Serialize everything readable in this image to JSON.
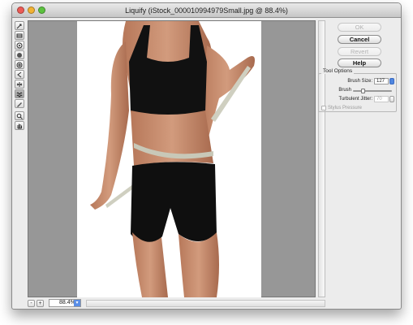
{
  "window": {
    "title": "Liquify (iStock_000010994979Small.jpg @ 88.4%)"
  },
  "tools": [
    {
      "name": "forward-warp-tool-icon",
      "active": false
    },
    {
      "name": "reconstruct-tool-icon",
      "active": false
    },
    {
      "name": "twirl-tool-icon",
      "active": false
    },
    {
      "name": "pucker-tool-icon",
      "active": false
    },
    {
      "name": "bloat-tool-icon",
      "active": false
    },
    {
      "name": "push-left-tool-icon",
      "active": false
    },
    {
      "name": "mirror-tool-icon",
      "active": false
    },
    {
      "name": "turbulence-tool-icon",
      "active": true
    },
    {
      "name": "freeze-mask-tool-icon",
      "active": false
    },
    {
      "name": "zoom-tool-icon",
      "active": false
    },
    {
      "name": "hand-tool-icon",
      "active": false
    }
  ],
  "buttons": {
    "ok": "OK",
    "cancel": "Cancel",
    "revert": "Revert",
    "help": "Help"
  },
  "tool_options": {
    "title": "Tool Options",
    "brush_size_label": "Brush Size:",
    "brush_size_value": "127",
    "brush_pressure_label": "Brush",
    "turbulent_jitter_label": "Turbulent Jitter:",
    "turbulent_jitter_value": "70",
    "stylus_pressure_label": "Stylus Pressure"
  },
  "status": {
    "zoom_value": "88.4%",
    "zoom_out": "-",
    "zoom_in": "+"
  },
  "colors": {
    "canvas_bg": "#979797",
    "accent": "#4f86e0",
    "panel_bg": "#ececec"
  }
}
